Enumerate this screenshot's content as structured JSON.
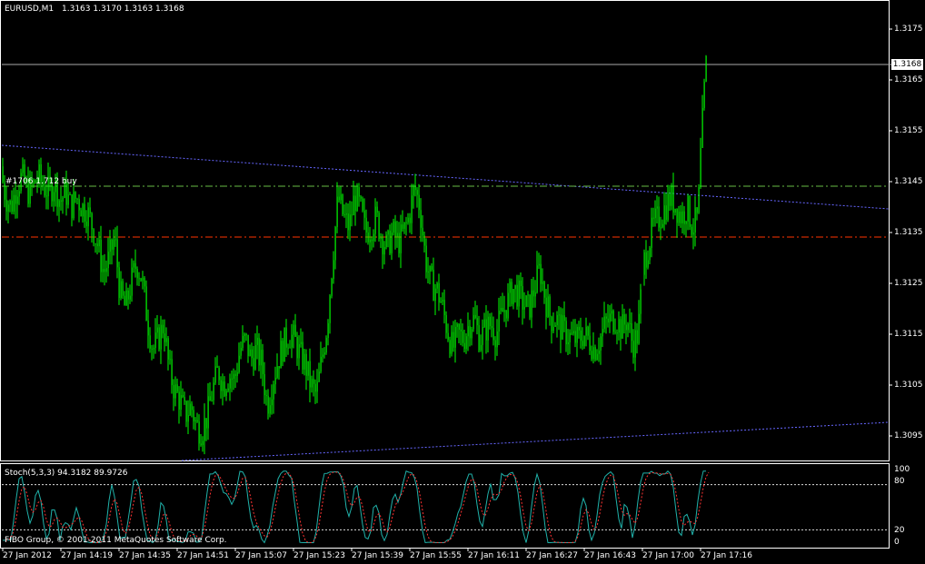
{
  "header": {
    "symbol_label": "EURUSD,M1",
    "ohlc_label": "1.3163 1.3170 1.3163 1.3168"
  },
  "order_label": "#1706 1.712 buy",
  "main_axis": {
    "price_labels": [
      "1.3175",
      "1.3165",
      "1.3155",
      "1.3145",
      "1.3135",
      "1.3125",
      "1.3115",
      "1.3105",
      "1.3095"
    ],
    "current_price": "1.3168"
  },
  "indicator": {
    "label": "Stoch(5,3,3) 94.3182 89.9726",
    "levels": [
      "100",
      "80",
      "20",
      "0"
    ]
  },
  "x_axis": {
    "labels": [
      "27 Jan 2012",
      "27 Jan 14:19",
      "27 Jan 14:35",
      "27 Jan 14:51",
      "27 Jan 15:07",
      "27 Jan 15:23",
      "27 Jan 15:39",
      "27 Jan 15:55",
      "27 Jan 16:11",
      "27 Jan 16:27",
      "27 Jan 16:43",
      "27 Jan 17:00",
      "27 Jan 17:16"
    ]
  },
  "footer": {
    "copyright": "FIBO Group, © 2001-2011 MetaQuotes Software Corp."
  },
  "colors": {
    "background": "#000000",
    "bull_candle": "#00ff00",
    "trendline": "#6666ff",
    "order_line": "#66bb44",
    "stop_line": "#ff3300",
    "stoch_main": "#20b2aa",
    "stoch_signal": "#ff3333"
  },
  "chart_data": {
    "type": "line",
    "title": "EURUSD,M1",
    "ylim": [
      1.3092,
      1.318
    ],
    "close_path": [
      [
        0,
        1.3148
      ],
      [
        6,
        1.3142
      ],
      [
        12,
        1.314
      ],
      [
        18,
        1.3144
      ],
      [
        24,
        1.3146
      ],
      [
        30,
        1.3143
      ],
      [
        36,
        1.3144
      ],
      [
        42,
        1.3146
      ],
      [
        48,
        1.3144
      ],
      [
        54,
        1.3143
      ],
      [
        60,
        1.3145
      ],
      [
        66,
        1.3141
      ],
      [
        72,
        1.3143
      ],
      [
        78,
        1.314
      ],
      [
        84,
        1.3142
      ],
      [
        90,
        1.314
      ],
      [
        96,
        1.3139
      ],
      [
        102,
        1.3136
      ],
      [
        108,
        1.3132
      ],
      [
        114,
        1.3127
      ],
      [
        120,
        1.313
      ],
      [
        126,
        1.3134
      ],
      [
        132,
        1.3123
      ],
      [
        138,
        1.312
      ],
      [
        144,
        1.3125
      ],
      [
        150,
        1.3129
      ],
      [
        156,
        1.3126
      ],
      [
        162,
        1.3118
      ],
      [
        168,
        1.3112
      ],
      [
        174,
        1.3114
      ],
      [
        180,
        1.3117
      ],
      [
        186,
        1.3108
      ],
      [
        192,
        1.3104
      ],
      [
        198,
        1.3102
      ],
      [
        204,
        1.3099
      ],
      [
        210,
        1.3101
      ],
      [
        216,
        1.3097
      ],
      [
        222,
        1.3096
      ],
      [
        228,
        1.3099
      ],
      [
        234,
        1.3104
      ],
      [
        240,
        1.3108
      ],
      [
        246,
        1.3105
      ],
      [
        252,
        1.3107
      ],
      [
        258,
        1.3106
      ],
      [
        264,
        1.3112
      ],
      [
        270,
        1.3114
      ],
      [
        276,
        1.311
      ],
      [
        282,
        1.3112
      ],
      [
        288,
        1.3109
      ],
      [
        294,
        1.3101
      ],
      [
        300,
        1.3106
      ],
      [
        306,
        1.311
      ],
      [
        312,
        1.3113
      ],
      [
        318,
        1.3115
      ],
      [
        324,
        1.3114
      ],
      [
        330,
        1.3111
      ],
      [
        336,
        1.3109
      ],
      [
        342,
        1.3105
      ],
      [
        348,
        1.3103
      ],
      [
        354,
        1.311
      ],
      [
        360,
        1.3117
      ],
      [
        366,
        1.313
      ],
      [
        372,
        1.3142
      ],
      [
        378,
        1.3138
      ],
      [
        384,
        1.3136
      ],
      [
        390,
        1.3142
      ],
      [
        396,
        1.314
      ],
      [
        402,
        1.3135
      ],
      [
        408,
        1.3136
      ],
      [
        414,
        1.3138
      ],
      [
        420,
        1.3134
      ],
      [
        426,
        1.3132
      ],
      [
        432,
        1.3135
      ],
      [
        438,
        1.3133
      ],
      [
        444,
        1.3135
      ],
      [
        450,
        1.3138
      ],
      [
        456,
        1.3144
      ],
      [
        462,
        1.314
      ],
      [
        468,
        1.313
      ],
      [
        474,
        1.3125
      ],
      [
        480,
        1.3124
      ],
      [
        486,
        1.3121
      ],
      [
        492,
        1.3116
      ],
      [
        498,
        1.3112
      ],
      [
        504,
        1.3115
      ],
      [
        510,
        1.3114
      ],
      [
        516,
        1.3117
      ],
      [
        522,
        1.3118
      ],
      [
        528,
        1.3114
      ],
      [
        534,
        1.3116
      ],
      [
        540,
        1.3117
      ],
      [
        546,
        1.3115
      ],
      [
        552,
        1.3119
      ],
      [
        558,
        1.3121
      ],
      [
        564,
        1.3124
      ],
      [
        570,
        1.3123
      ],
      [
        576,
        1.3121
      ],
      [
        582,
        1.312
      ],
      [
        588,
        1.3124
      ],
      [
        594,
        1.3128
      ],
      [
        600,
        1.3122
      ],
      [
        606,
        1.3118
      ],
      [
        612,
        1.3118
      ],
      [
        618,
        1.3116
      ],
      [
        624,
        1.3115
      ],
      [
        630,
        1.3114
      ],
      [
        636,
        1.3114
      ],
      [
        642,
        1.3115
      ],
      [
        648,
        1.3114
      ],
      [
        654,
        1.3112
      ],
      [
        660,
        1.3114
      ],
      [
        666,
        1.3117
      ],
      [
        672,
        1.3118
      ],
      [
        678,
        1.3118
      ],
      [
        684,
        1.3116
      ],
      [
        690,
        1.3118
      ],
      [
        696,
        1.3113
      ],
      [
        702,
        1.3115
      ],
      [
        708,
        1.3129
      ],
      [
        714,
        1.3133
      ],
      [
        720,
        1.3137
      ],
      [
        726,
        1.3138
      ],
      [
        732,
        1.314
      ],
      [
        738,
        1.3142
      ],
      [
        744,
        1.314
      ],
      [
        750,
        1.3138
      ],
      [
        756,
        1.314
      ],
      [
        762,
        1.3136
      ],
      [
        768,
        1.3138
      ],
      [
        771,
        1.315
      ],
      [
        774,
        1.316
      ],
      [
        777,
        1.3168
      ],
      [
        780,
        1.3168
      ]
    ]
  }
}
